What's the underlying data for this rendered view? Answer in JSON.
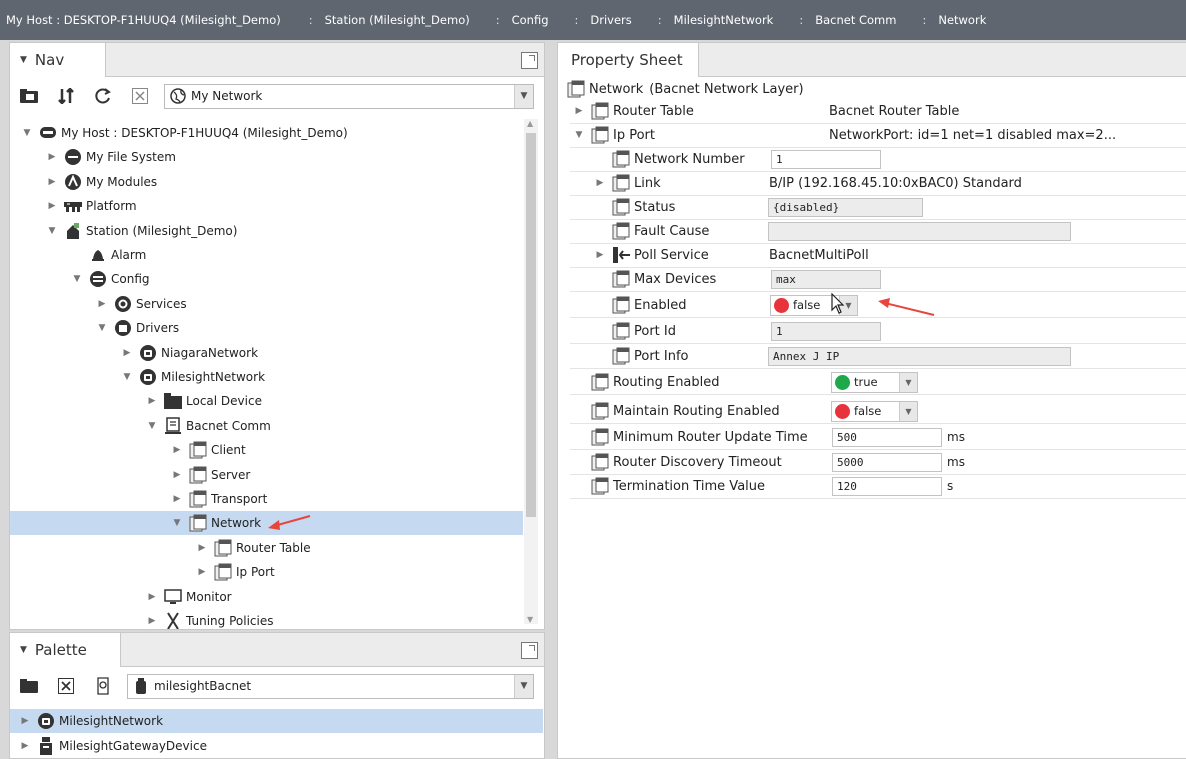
{
  "breadcrumb": [
    "My Host : DESKTOP-F1HUUQ4 (Milesight_Demo)",
    "Station (Milesight_Demo)",
    "Config",
    "Drivers",
    "MilesightNetwork",
    "Bacnet Comm",
    "Network"
  ],
  "breadcrumb_sep": ":",
  "nav": {
    "title": "Nav",
    "selector": "My Network",
    "tree": [
      {
        "label": "My Host : DESKTOP-F1HUUQ4 (Milesight_Demo)",
        "icon": "host-icon"
      },
      {
        "label": "My File System",
        "icon": "filesystem-icon"
      },
      {
        "label": "My Modules",
        "icon": "modules-icon"
      },
      {
        "label": "Platform",
        "icon": "platform-icon"
      },
      {
        "label": "Station (Milesight_Demo)",
        "icon": "station-icon"
      },
      {
        "label": "Alarm",
        "icon": "bell-icon"
      },
      {
        "label": "Config",
        "icon": "database-icon"
      },
      {
        "label": "Services",
        "icon": "services-icon"
      },
      {
        "label": "Drivers",
        "icon": "drivers-icon"
      },
      {
        "label": "NiagaraNetwork",
        "icon": "network-icon"
      },
      {
        "label": "MilesightNetwork",
        "icon": "network-icon"
      },
      {
        "label": "Local Device",
        "icon": "folder-icon"
      },
      {
        "label": "Bacnet Comm",
        "icon": "comm-icon"
      },
      {
        "label": "Client",
        "icon": "component-icon"
      },
      {
        "label": "Server",
        "icon": "component-icon"
      },
      {
        "label": "Transport",
        "icon": "component-icon"
      },
      {
        "label": "Network",
        "icon": "component-icon"
      },
      {
        "label": "Router Table",
        "icon": "component-icon"
      },
      {
        "label": "Ip Port",
        "icon": "component-icon"
      },
      {
        "label": "Monitor",
        "icon": "monitor-icon"
      },
      {
        "label": "Tuning Policies",
        "icon": "tuning-icon"
      }
    ]
  },
  "palette": {
    "title": "Palette",
    "selector": "milesightBacnet",
    "items": [
      {
        "label": "MilesightNetwork",
        "icon": "network-icon"
      },
      {
        "label": "MilesightGatewayDevice",
        "icon": "gateway-icon"
      }
    ]
  },
  "property_sheet": {
    "title": "Property Sheet",
    "root_name": "Network",
    "root_type": "(Bacnet Network Layer)",
    "rows": [
      {
        "name": "Router Table",
        "value": "Bacnet Router Table"
      },
      {
        "name": "Ip Port",
        "value": "NetworkPort: id=1 net=1 disabled max=2..."
      },
      {
        "name": "Network Number",
        "value": "1"
      },
      {
        "name": "Link",
        "value": "B/IP (192.168.45.10:0xBAC0) Standard"
      },
      {
        "name": "Status",
        "value": "{disabled}"
      },
      {
        "name": "Fault Cause",
        "value": ""
      },
      {
        "name": "Poll Service",
        "value": "BacnetMultiPoll"
      },
      {
        "name": "Max Devices",
        "value": "max"
      },
      {
        "name": "Enabled",
        "value": "false"
      },
      {
        "name": "Port Id",
        "value": "1"
      },
      {
        "name": "Port Info",
        "value": "Annex J IP"
      },
      {
        "name": "Routing Enabled",
        "value": "true"
      },
      {
        "name": "Maintain Routing Enabled",
        "value": "false"
      },
      {
        "name": "Minimum Router Update Time",
        "value": "500",
        "unit": "ms"
      },
      {
        "name": "Router Discovery Timeout",
        "value": "5000",
        "unit": "ms"
      },
      {
        "name": "Termination Time Value",
        "value": "120",
        "unit": "s"
      }
    ]
  },
  "colors": {
    "header": "#5f6670",
    "selection": "#c5d9f1",
    "true_dot": "#1ea84a",
    "false_dot": "#e8323c",
    "annotation": "#e8453c"
  }
}
